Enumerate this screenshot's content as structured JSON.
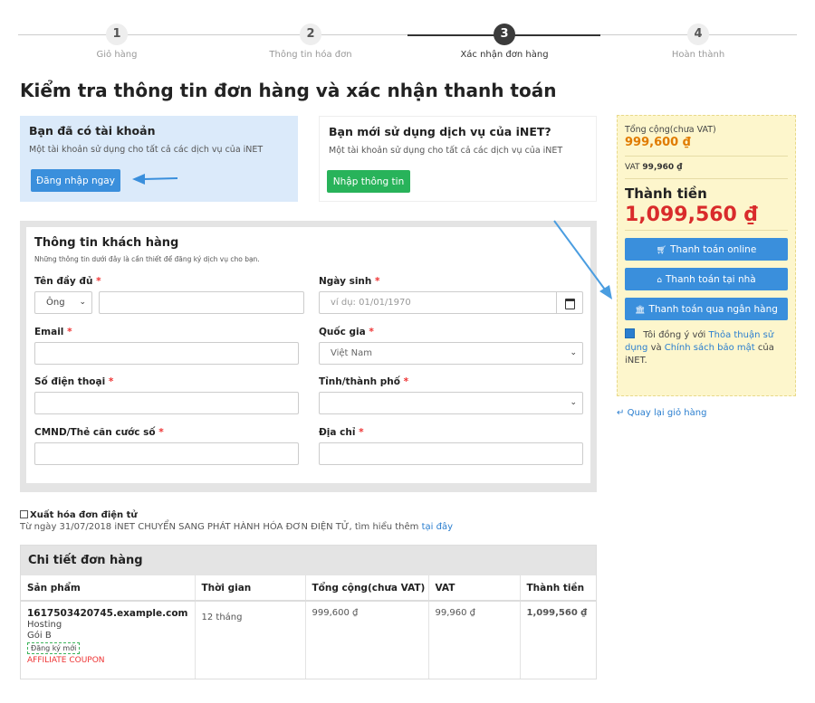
{
  "stepper": {
    "steps": [
      {
        "num": "1",
        "label": "Giỏ hàng"
      },
      {
        "num": "2",
        "label": "Thông tin hóa đơn"
      },
      {
        "num": "3",
        "label": "Xác nhận đơn hàng"
      },
      {
        "num": "4",
        "label": "Hoàn thành"
      }
    ],
    "active_step": 3
  },
  "page_title": "Kiểm tra thông tin đơn hàng và xác nhận thanh toán",
  "existing_account": {
    "title": "Bạn đã có tài khoản",
    "desc": "Một tài khoản sử dụng cho tất cả các dịch vụ của iNET",
    "button": "Đăng nhập ngay"
  },
  "new_account": {
    "title": "Bạn mới sử dụng dịch vụ của iNET?",
    "desc": "Một tài khoản sử dụng cho tất cả các dịch vụ của iNET",
    "button": "Nhập thông tin"
  },
  "customer_form": {
    "title": "Thông tin khách hàng",
    "subtitle": "Những thông tin dưới đây là cần thiết để đăng ký dịch vụ cho bạn.",
    "fullname_label": "Tên đầy đủ",
    "salutation_value": "Ông",
    "fullname_value": "",
    "dob_label": "Ngày sinh",
    "dob_placeholder": "ví dụ: 01/01/1970",
    "email_label": "Email",
    "email_value": "",
    "country_label": "Quốc gia",
    "country_value": "Việt Nam",
    "phone_label": "Số điện thoại",
    "phone_value": "",
    "province_label": "Tỉnh/thành phố",
    "province_value": "",
    "id_label": "CMND/Thẻ căn cước số",
    "id_value": "",
    "address_label": "Địa chỉ",
    "address_value": "",
    "required_mark": "*"
  },
  "einvoice": {
    "label": "Xuất hóa đơn điện tử",
    "note": "Từ ngày 31/07/2018 iNET CHUYỂN SANG PHÁT HÀNH HÓA ĐƠN ĐIỆN TỬ, tìm hiểu thêm",
    "link": "tại đây"
  },
  "order": {
    "title": "Chi tiết đơn hàng",
    "columns": [
      "Sản phẩm",
      "Thời gian",
      "Tổng cộng(chưa VAT)",
      "VAT",
      "Thành tiền"
    ],
    "row": {
      "domain": "1617503420745.example.com",
      "type": "Hosting",
      "plan": "Gói B",
      "badge": "Đăng ký mới",
      "coupon": "AFFILIATE COUPON",
      "duration": "12 tháng",
      "subtotal": "999,600 ₫",
      "vat": "99,960 ₫",
      "total": "1,099,560 ₫"
    }
  },
  "summary": {
    "subtotal_label": "Tổng cộng(chưa VAT)",
    "subtotal_value": "999,600 ₫",
    "vat_label": "VAT",
    "vat_value": "99,960 ₫",
    "total_label": "Thành tiền",
    "total_value": "1,099,560 ₫",
    "pay_online": "Thanh toán online",
    "pay_home": "Thanh toán tại nhà",
    "pay_bank": "Thanh toán qua ngân hàng",
    "agree_prefix": "Tôi đồng ý với",
    "agree_terms": "Thỏa thuận sử dụng",
    "agree_and": "và",
    "agree_privacy": "Chính sách bảo mật",
    "agree_suffix": "của iNET."
  },
  "back_link": "Quay lại giỏ hàng",
  "colors": {
    "primary_blue": "#3a8fdc",
    "green": "#28b35a",
    "price_orange": "#e07b00",
    "total_red": "#d92b2b"
  }
}
